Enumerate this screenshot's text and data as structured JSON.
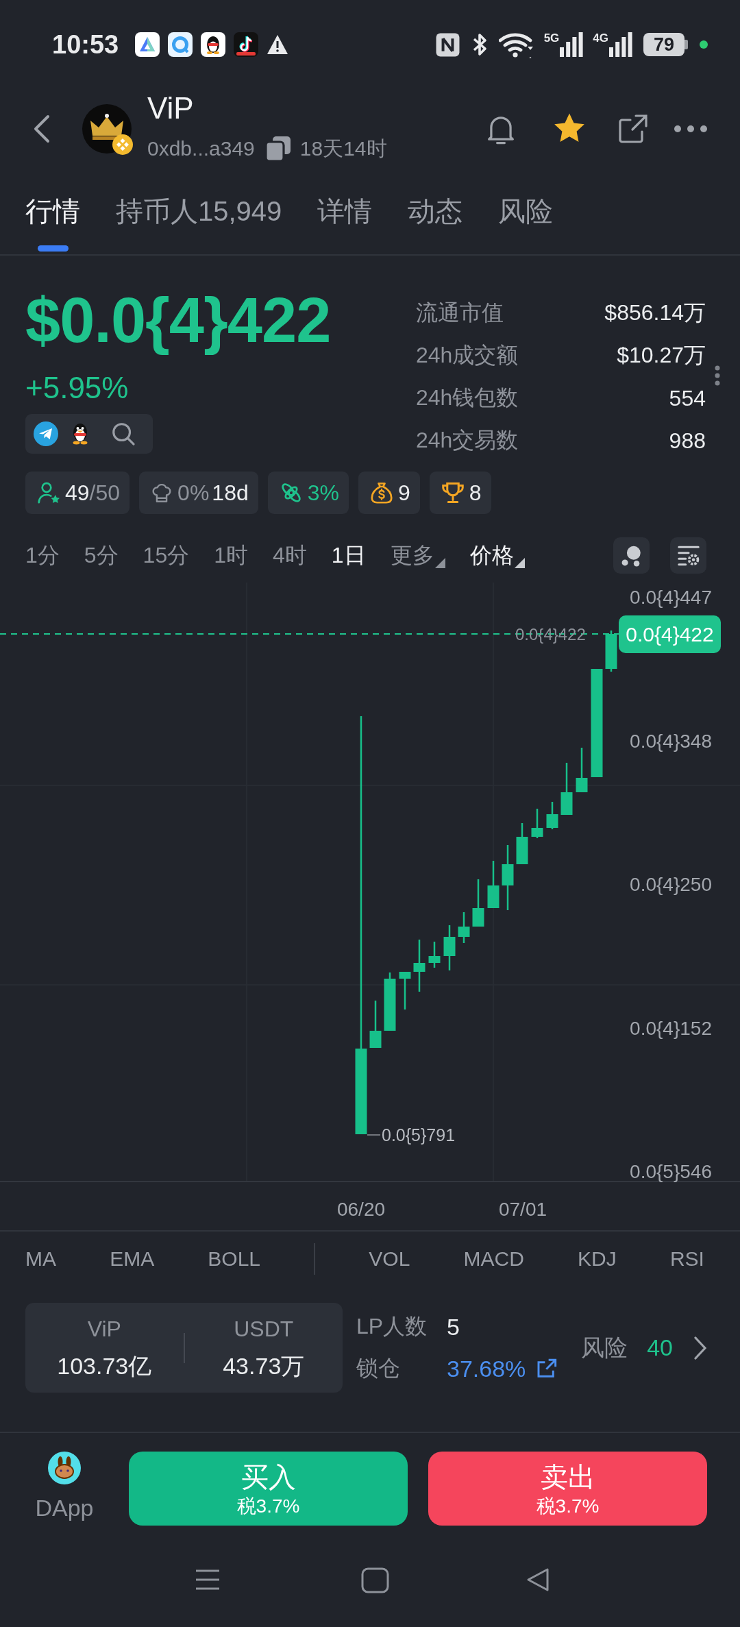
{
  "status_bar": {
    "time": "10:53",
    "networks": [
      "5G",
      "4G"
    ],
    "battery": "79"
  },
  "header": {
    "title": "ViP",
    "address": "0xdb...a349",
    "age": "18天14时",
    "favorite": true
  },
  "tabs": [
    {
      "label": "行情",
      "selected": true
    },
    {
      "label": "持币人15,949",
      "selected": false
    },
    {
      "label": "详情",
      "selected": false
    },
    {
      "label": "动态",
      "selected": false
    },
    {
      "label": "风险",
      "selected": false
    }
  ],
  "price": {
    "value": "$0.0{4}422",
    "change": "+5.95%"
  },
  "stats": [
    {
      "label": "流通市值",
      "value": "$856.14万"
    },
    {
      "label": "24h成交额",
      "value": "$10.27万"
    },
    {
      "label": "24h钱包数",
      "value": "554"
    },
    {
      "label": "24h交易数",
      "value": "988"
    }
  ],
  "badges": [
    {
      "kind": "holders",
      "value": "49",
      "total": "/50"
    },
    {
      "kind": "dev",
      "share": "0%",
      "age": "18d"
    },
    {
      "kind": "bundle",
      "value": "3%"
    },
    {
      "kind": "money",
      "value": "9"
    },
    {
      "kind": "trophy",
      "value": "8"
    }
  ],
  "timeframes": [
    {
      "label": "1分",
      "selected": false
    },
    {
      "label": "5分",
      "selected": false
    },
    {
      "label": "15分",
      "selected": false
    },
    {
      "label": "1时",
      "selected": false
    },
    {
      "label": "4时",
      "selected": false
    },
    {
      "label": "1日",
      "selected": true
    }
  ],
  "chart_menus": [
    {
      "label": "更多",
      "selected": false
    },
    {
      "label": "价格",
      "selected": true
    }
  ],
  "chart": {
    "y_labels": [
      "0.0{4}447",
      "0.0{4}348",
      "0.0{4}250",
      "0.0{4}152",
      "0.0{5}546"
    ],
    "last_price_line_label": "0.0{4}422",
    "last_price_tag": "0.0{4}422",
    "low_label": "0.0{5}791",
    "x_labels": [
      "06/20",
      "07/01"
    ]
  },
  "indicators": {
    "main": [
      "MA",
      "EMA",
      "BOLL"
    ],
    "sub": [
      "VOL",
      "MACD",
      "KDJ",
      "RSI"
    ]
  },
  "liquidity": {
    "pool": [
      {
        "token": "ViP",
        "amount": "103.73亿"
      },
      {
        "token": "USDT",
        "amount": "43.73万"
      }
    ],
    "lp_label": "LP人数",
    "lp_count": "5",
    "lock_label": "锁仓",
    "lock_value": "37.68%",
    "risk_label": "风险",
    "risk_score": "40"
  },
  "bottom_bar": {
    "dapp_label": "DApp",
    "actions": [
      {
        "kind": "buy",
        "label": "买入",
        "tax": "税3.7%"
      },
      {
        "kind": "sell",
        "label": "卖出",
        "tax": "税3.7%"
      }
    ]
  }
}
